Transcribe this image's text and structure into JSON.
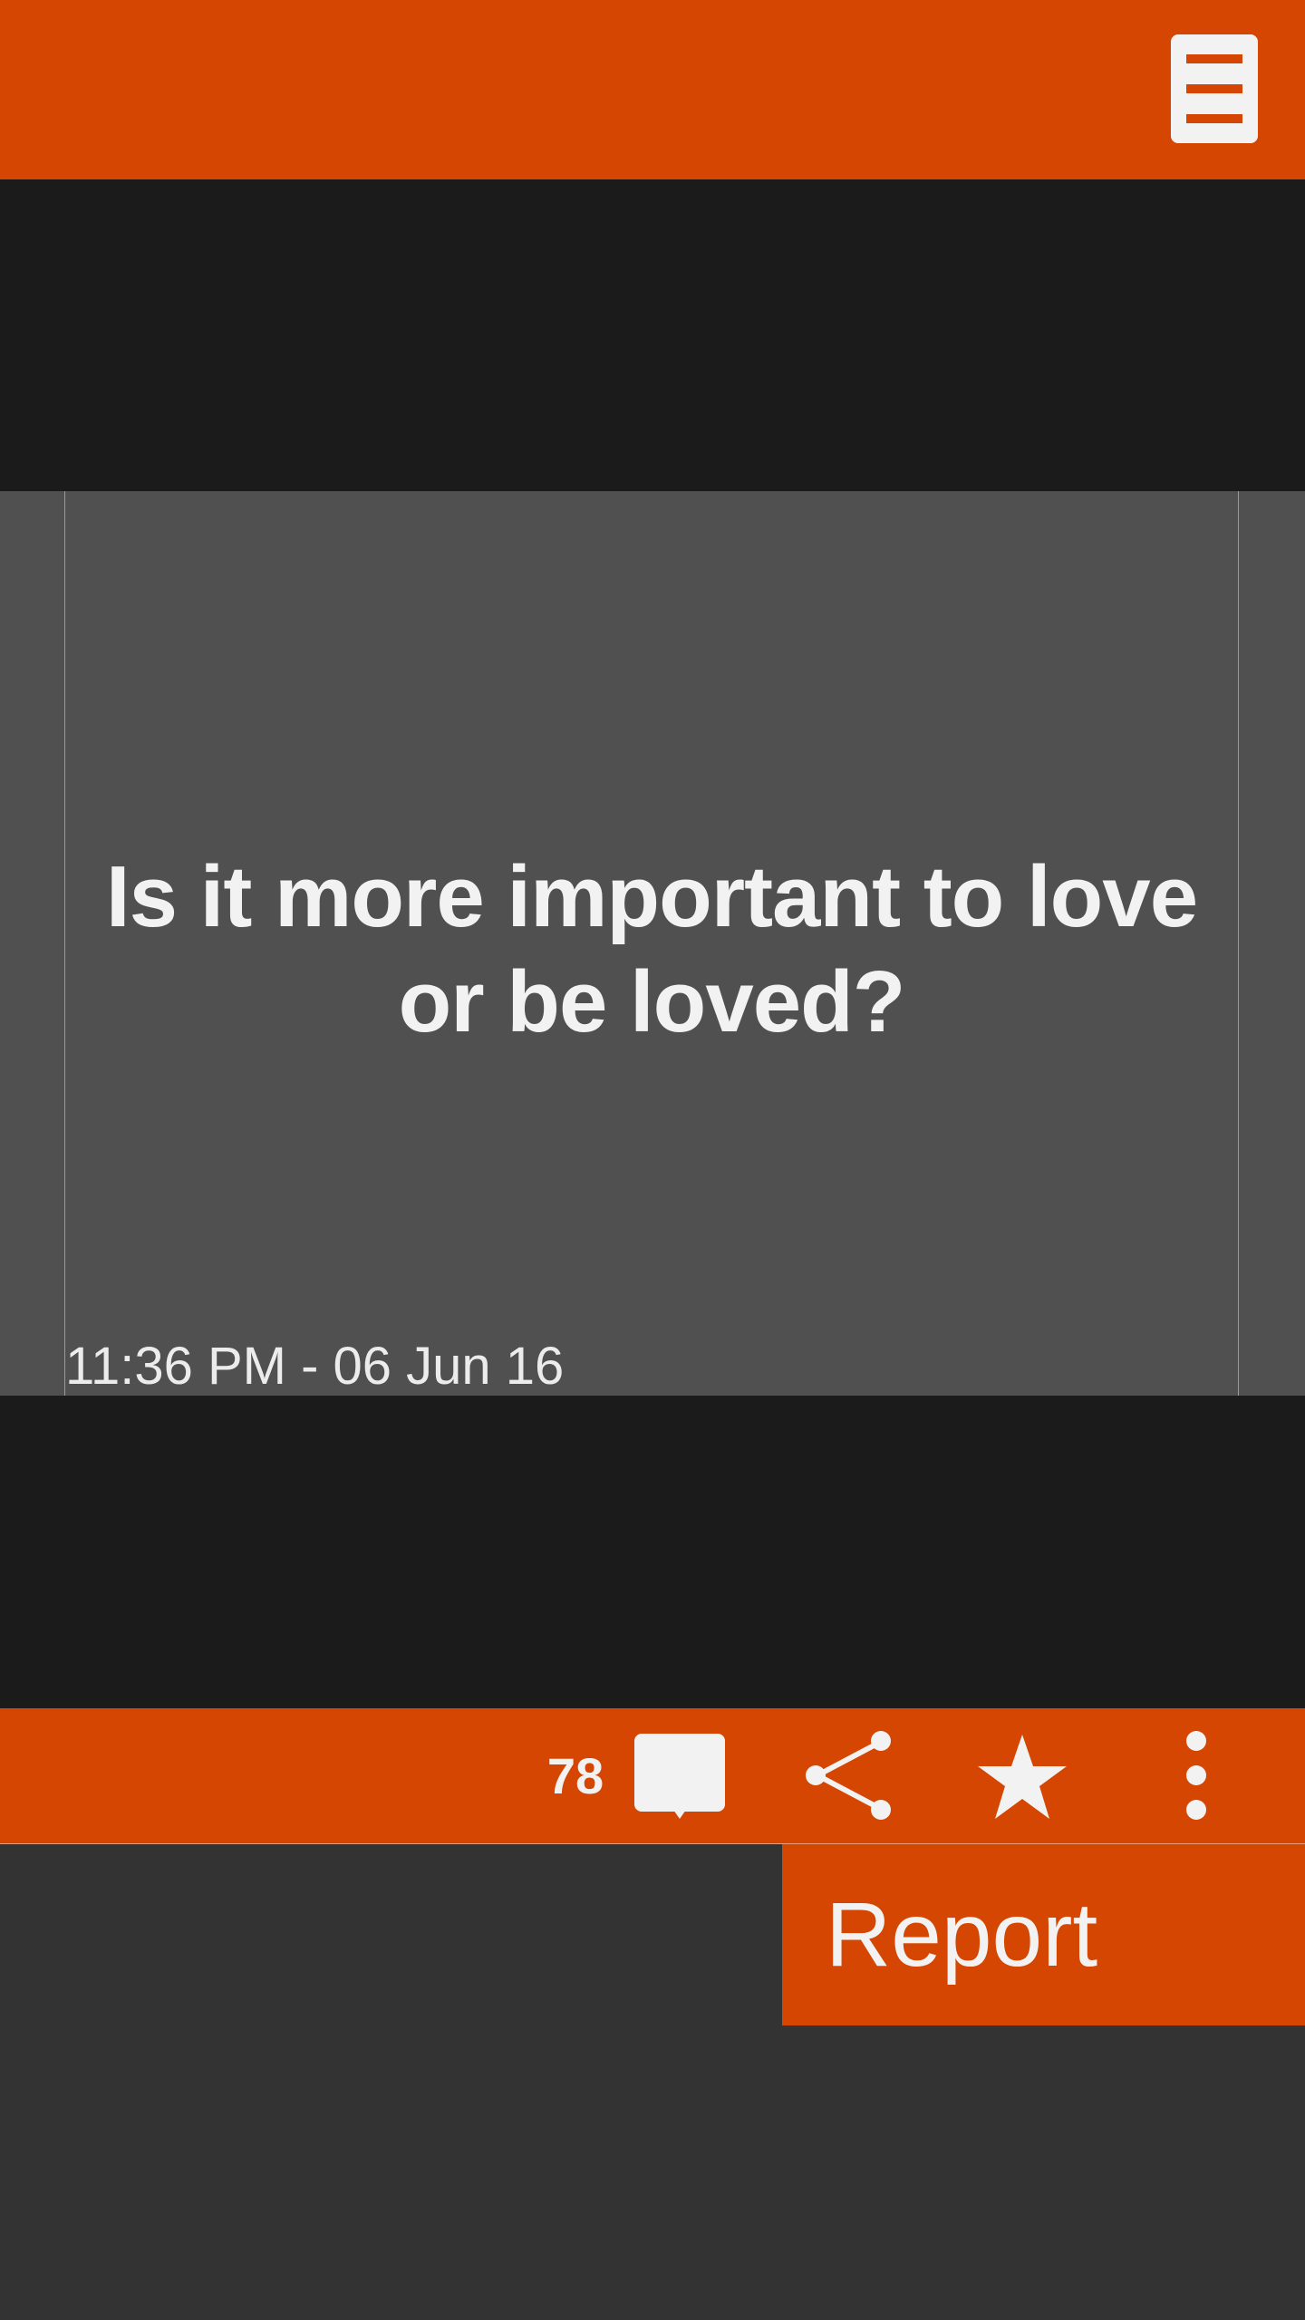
{
  "colors": {
    "accent": "#D44602",
    "band": "#1B1B1B",
    "card": "#505050",
    "background": "#333333",
    "text": "#F2F2F2"
  },
  "header": {
    "menu_icon": "hamburger-menu-icon"
  },
  "post": {
    "question": "Is it more important to love or be loved?",
    "timestamp": "11:36 PM - 06 Jun 16"
  },
  "actions": {
    "comment_count": "78",
    "comment_icon": "comment-bubble-icon",
    "share_icon": "share-icon",
    "favorite_icon": "star-icon",
    "more_icon": "more-vertical-icon"
  },
  "overflow_menu": {
    "items": [
      {
        "label": "Report"
      }
    ]
  }
}
